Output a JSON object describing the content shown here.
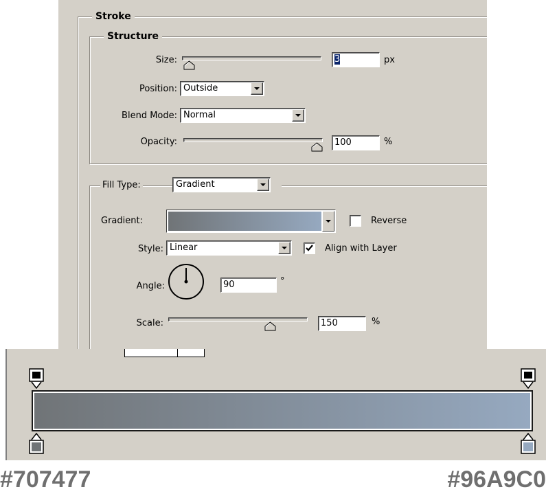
{
  "stroke": {
    "title": "Stroke",
    "structure": {
      "title": "Structure",
      "size": {
        "label": "Size:",
        "value": "3",
        "unit": "px",
        "slider_fraction": 0.01
      },
      "position": {
        "label": "Position:",
        "value": "Outside"
      },
      "blend_mode": {
        "label": "Blend Mode:",
        "value": "Normal"
      },
      "opacity": {
        "label": "Opacity:",
        "value": "100",
        "unit": "%",
        "slider_fraction": 1.0
      }
    },
    "fill_type": {
      "label": "Fill Type:",
      "value": "Gradient"
    },
    "gradient": {
      "label": "Gradient:",
      "reverse_label": "Reverse",
      "reverse_checked": false,
      "start_color": "#707477",
      "end_color": "#96A9C0"
    },
    "style": {
      "label": "Style:",
      "value": "Linear",
      "align_label": "Align with Layer",
      "align_checked": true
    },
    "angle": {
      "label": "Angle:",
      "value": "90",
      "unit": "°",
      "degrees": 90
    },
    "scale": {
      "label": "Scale:",
      "value": "150",
      "unit": "%",
      "slider_fraction": 0.75
    }
  },
  "gradient_editor": {
    "start_color": "#707477",
    "end_color": "#96A9C0",
    "start_label": "#707477",
    "end_label": "#96A9C0",
    "icons": [
      "opacity-stop-icon",
      "color-stop-icon"
    ]
  }
}
